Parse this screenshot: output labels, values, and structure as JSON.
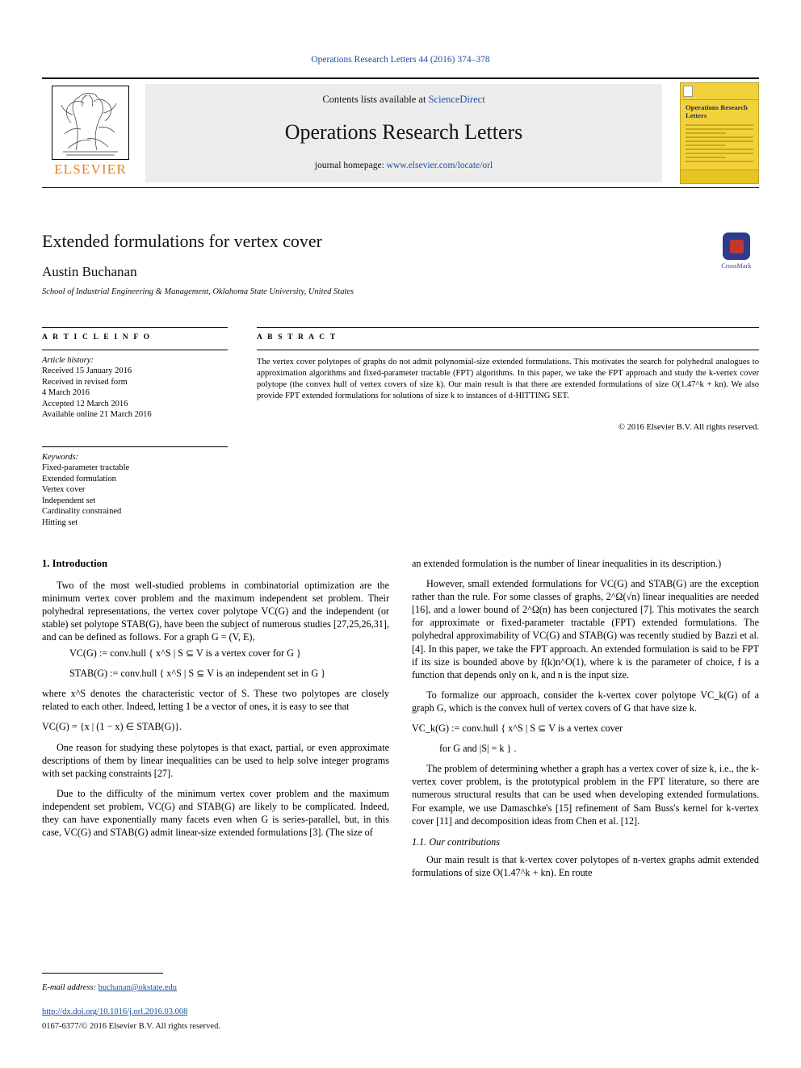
{
  "running_head": "Operations Research Letters 44 (2016) 374–378",
  "masthead": {
    "publisher_word": "ELSEVIER",
    "contents_prefix": "Contents lists available at ",
    "contents_link": "ScienceDirect",
    "journal_title": "Operations Research Letters",
    "homepage_prefix": "journal homepage: ",
    "homepage_link": "www.elsevier.com/locate/orl",
    "cover_title": "Operations Research Letters"
  },
  "article": {
    "title": "Extended formulations for vertex cover",
    "author": "Austin Buchanan",
    "affiliation": "School of Industrial Engineering & Management, Oklahoma State University, United States",
    "crossmark_label": "CrossMark"
  },
  "info": {
    "heading": "A R T I C L E    I N F O",
    "history_title": "Article history:",
    "history_lines": [
      "Received 15 January 2016",
      "Received in revised form",
      "4 March 2016",
      "Accepted 12 March 2016",
      "Available online 21 March 2016"
    ],
    "keywords_title": "Keywords:",
    "keywords": [
      "Fixed-parameter tractable",
      "Extended formulation",
      "Vertex cover",
      "Independent set",
      "Cardinality constrained",
      "Hitting set"
    ]
  },
  "abstract": {
    "heading": "A B S T R A C T",
    "text": "The vertex cover polytopes of graphs do not admit polynomial-size extended formulations. This motivates the search for polyhedral analogues to approximation algorithms and fixed-parameter tractable (FPT) algorithms. In this paper, we take the FPT approach and study the k-vertex cover polytope (the convex hull of vertex covers of size k). Our main result is that there are extended formulations of size O(1.47^k + kn). We also provide FPT extended formulations for solutions of size k to instances of d-HITTING SET.",
    "copyright": "© 2016 Elsevier B.V. All rights reserved."
  },
  "body": {
    "section1": "1.  Introduction",
    "left_paragraphs": [
      "Two of the most well-studied problems in combinatorial optimization are the minimum vertex cover problem and the maximum independent set problem. Their polyhedral representations, the vertex cover polytope VC(G) and the independent (or stable) set polytope STAB(G), have been the subject of numerous studies [27,25,26,31], and can be defined as follows. For a graph G = (V, E),",
      "where x^S denotes the characteristic vector of S. These two polytopes are closely related to each other. Indeed, letting 1 be a vector of ones, it is easy to see that",
      "One reason for studying these polytopes is that exact, partial, or even approximate descriptions of them by linear inequalities can be used to help solve integer programs with set packing constraints [27].",
      "Due to the difficulty of the minimum vertex cover problem and the maximum independent set problem, VC(G) and STAB(G) are likely to be complicated. Indeed, they can have exponentially many facets even when G is series-parallel, but, in this case, VC(G) and STAB(G) admit linear-size extended formulations [3]. (The size of"
    ],
    "left_equations": [
      "VC(G) := conv.hull { x^S | S ⊆ V is a vertex cover for G }",
      "STAB(G) := conv.hull { x^S | S ⊆ V is an independent set in G }",
      "VC(G) = {x | (1 − x) ∈ STAB(G)}."
    ],
    "right_paragraphs": [
      "an extended formulation is the number of linear inequalities in its description.)",
      "However, small extended formulations for VC(G) and STAB(G) are the exception rather than the rule. For some classes of graphs, 2^Ω(√n) linear inequalities are needed [16], and a lower bound of 2^Ω(n) has been conjectured [7]. This motivates the search for approximate or fixed-parameter tractable (FPT) extended formulations. The polyhedral approximability of VC(G) and STAB(G) was recently studied by Bazzi et al. [4]. In this paper, we take the FPT approach. An extended formulation is said to be FPT if its size is bounded above by f(k)n^O(1), where k is the parameter of choice, f is a function that depends only on k, and n is the input size.",
      "To formalize our approach, consider the k-vertex cover polytope VC_k(G) of a graph G, which is the convex hull of vertex covers of G that have size k.",
      "The problem of determining whether a graph has a vertex cover of size k, i.e., the k-vertex cover problem, is the prototypical problem in the FPT literature, so there are numerous structural results that can be used when developing extended formulations. For example, we use Damaschke's [15] refinement of Sam Buss's kernel for k-vertex cover [11] and decomposition ideas from Chen et al. [12]."
    ],
    "right_equations": [
      "VC_k(G) := conv.hull { x^S | S ⊆ V is a vertex cover",
      "for G and |S| = k } ."
    ],
    "subsection11": "1.1.  Our contributions",
    "right_last": "Our main result is that k-vertex cover polytopes of n-vertex graphs admit extended formulations of size O(1.47^k + kn). En route"
  },
  "footer": {
    "email_label": "E-mail address: ",
    "email": "buchanan@okstate.edu",
    "doi": "http://dx.doi.org/10.1016/j.orl.2016.03.008",
    "issn": "0167-6377/© 2016 Elsevier B.V. All rights reserved."
  }
}
